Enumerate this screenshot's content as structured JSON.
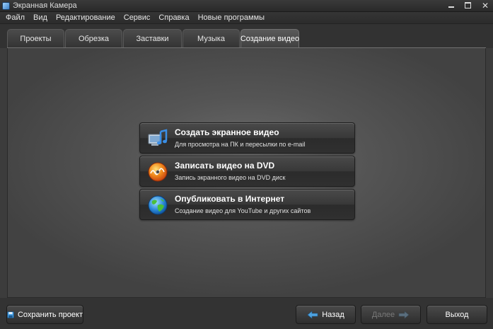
{
  "window": {
    "title": "Экранная Камера"
  },
  "menu": [
    "Файл",
    "Вид",
    "Редактирование",
    "Сервис",
    "Справка",
    "Новые программы"
  ],
  "tabs": [
    {
      "label": "Проекты",
      "active": false
    },
    {
      "label": "Обрезка",
      "active": false
    },
    {
      "label": "Заставки",
      "active": false
    },
    {
      "label": "Музыка",
      "active": false
    },
    {
      "label": "Создание видео",
      "active": true
    }
  ],
  "options": [
    {
      "title": "Создать экранное видео",
      "subtitle": "Для просмотра на ПК и пересылки по e-mail",
      "icon": "monitor-music-icon"
    },
    {
      "title": "Записать видео на DVD",
      "subtitle": "Запись экранного видео на DVD диск",
      "icon": "dvd-disc-icon"
    },
    {
      "title": "Опубликовать в Интернет",
      "subtitle": "Создание видео для YouTube и других сайтов",
      "icon": "globe-icon"
    }
  ],
  "footer": {
    "save_label": "Сохранить проект",
    "back_label": "Назад",
    "next_label": "Далее",
    "exit_label": "Выход"
  },
  "colors": {
    "background": "#3c3c3c",
    "stage_center": "#6d6d6d",
    "accent_arrow": "#4fa3e0"
  }
}
